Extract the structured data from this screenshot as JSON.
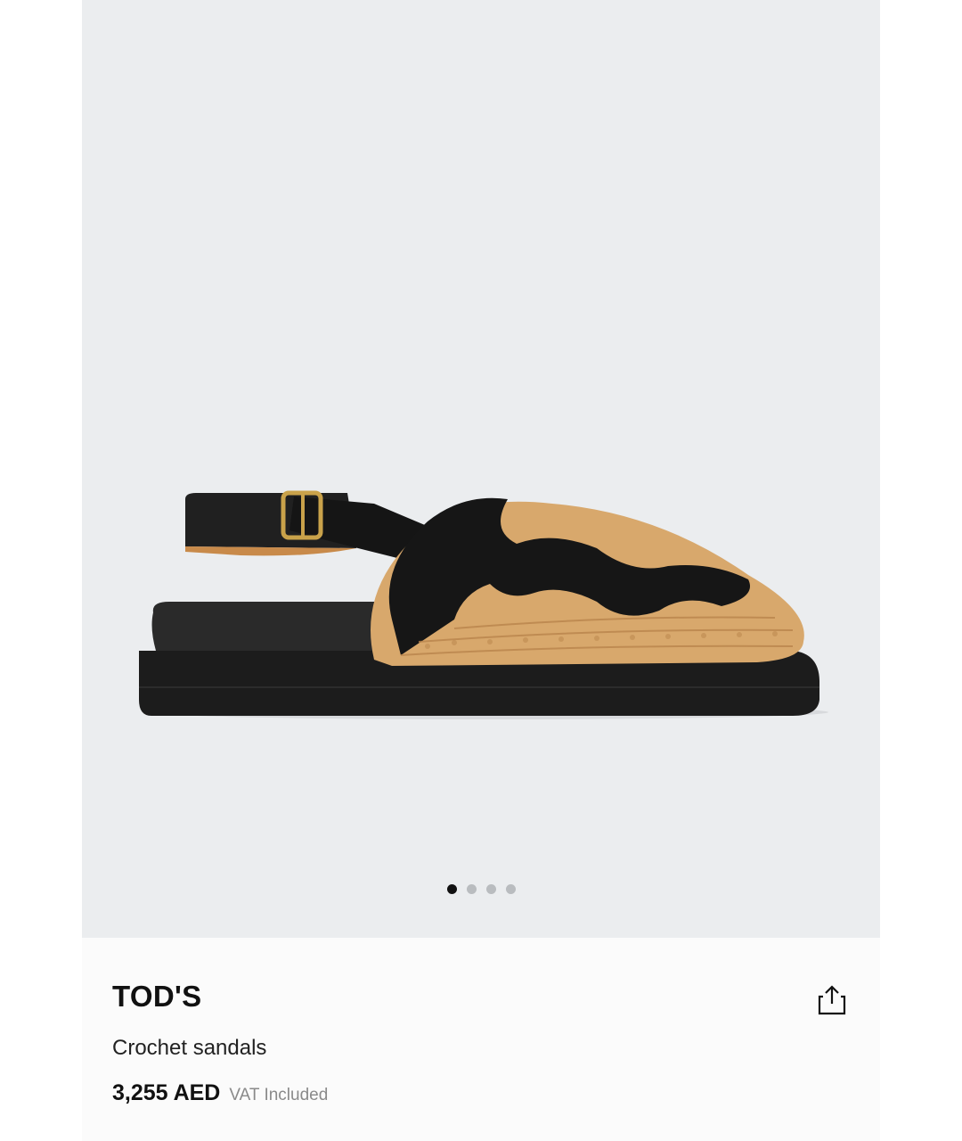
{
  "gallery": {
    "image_alt": "Crochet sandal",
    "slides": 4,
    "active_slide": 1
  },
  "product": {
    "brand": "TOD'S",
    "name": "Crochet sandals",
    "price": "3,255 AED",
    "vat_note": "VAT Included"
  },
  "icons": {
    "share": "share-icon"
  },
  "colors": {
    "hero_bg": "#ebedef",
    "text": "#111111",
    "muted": "#8a8a8a"
  }
}
